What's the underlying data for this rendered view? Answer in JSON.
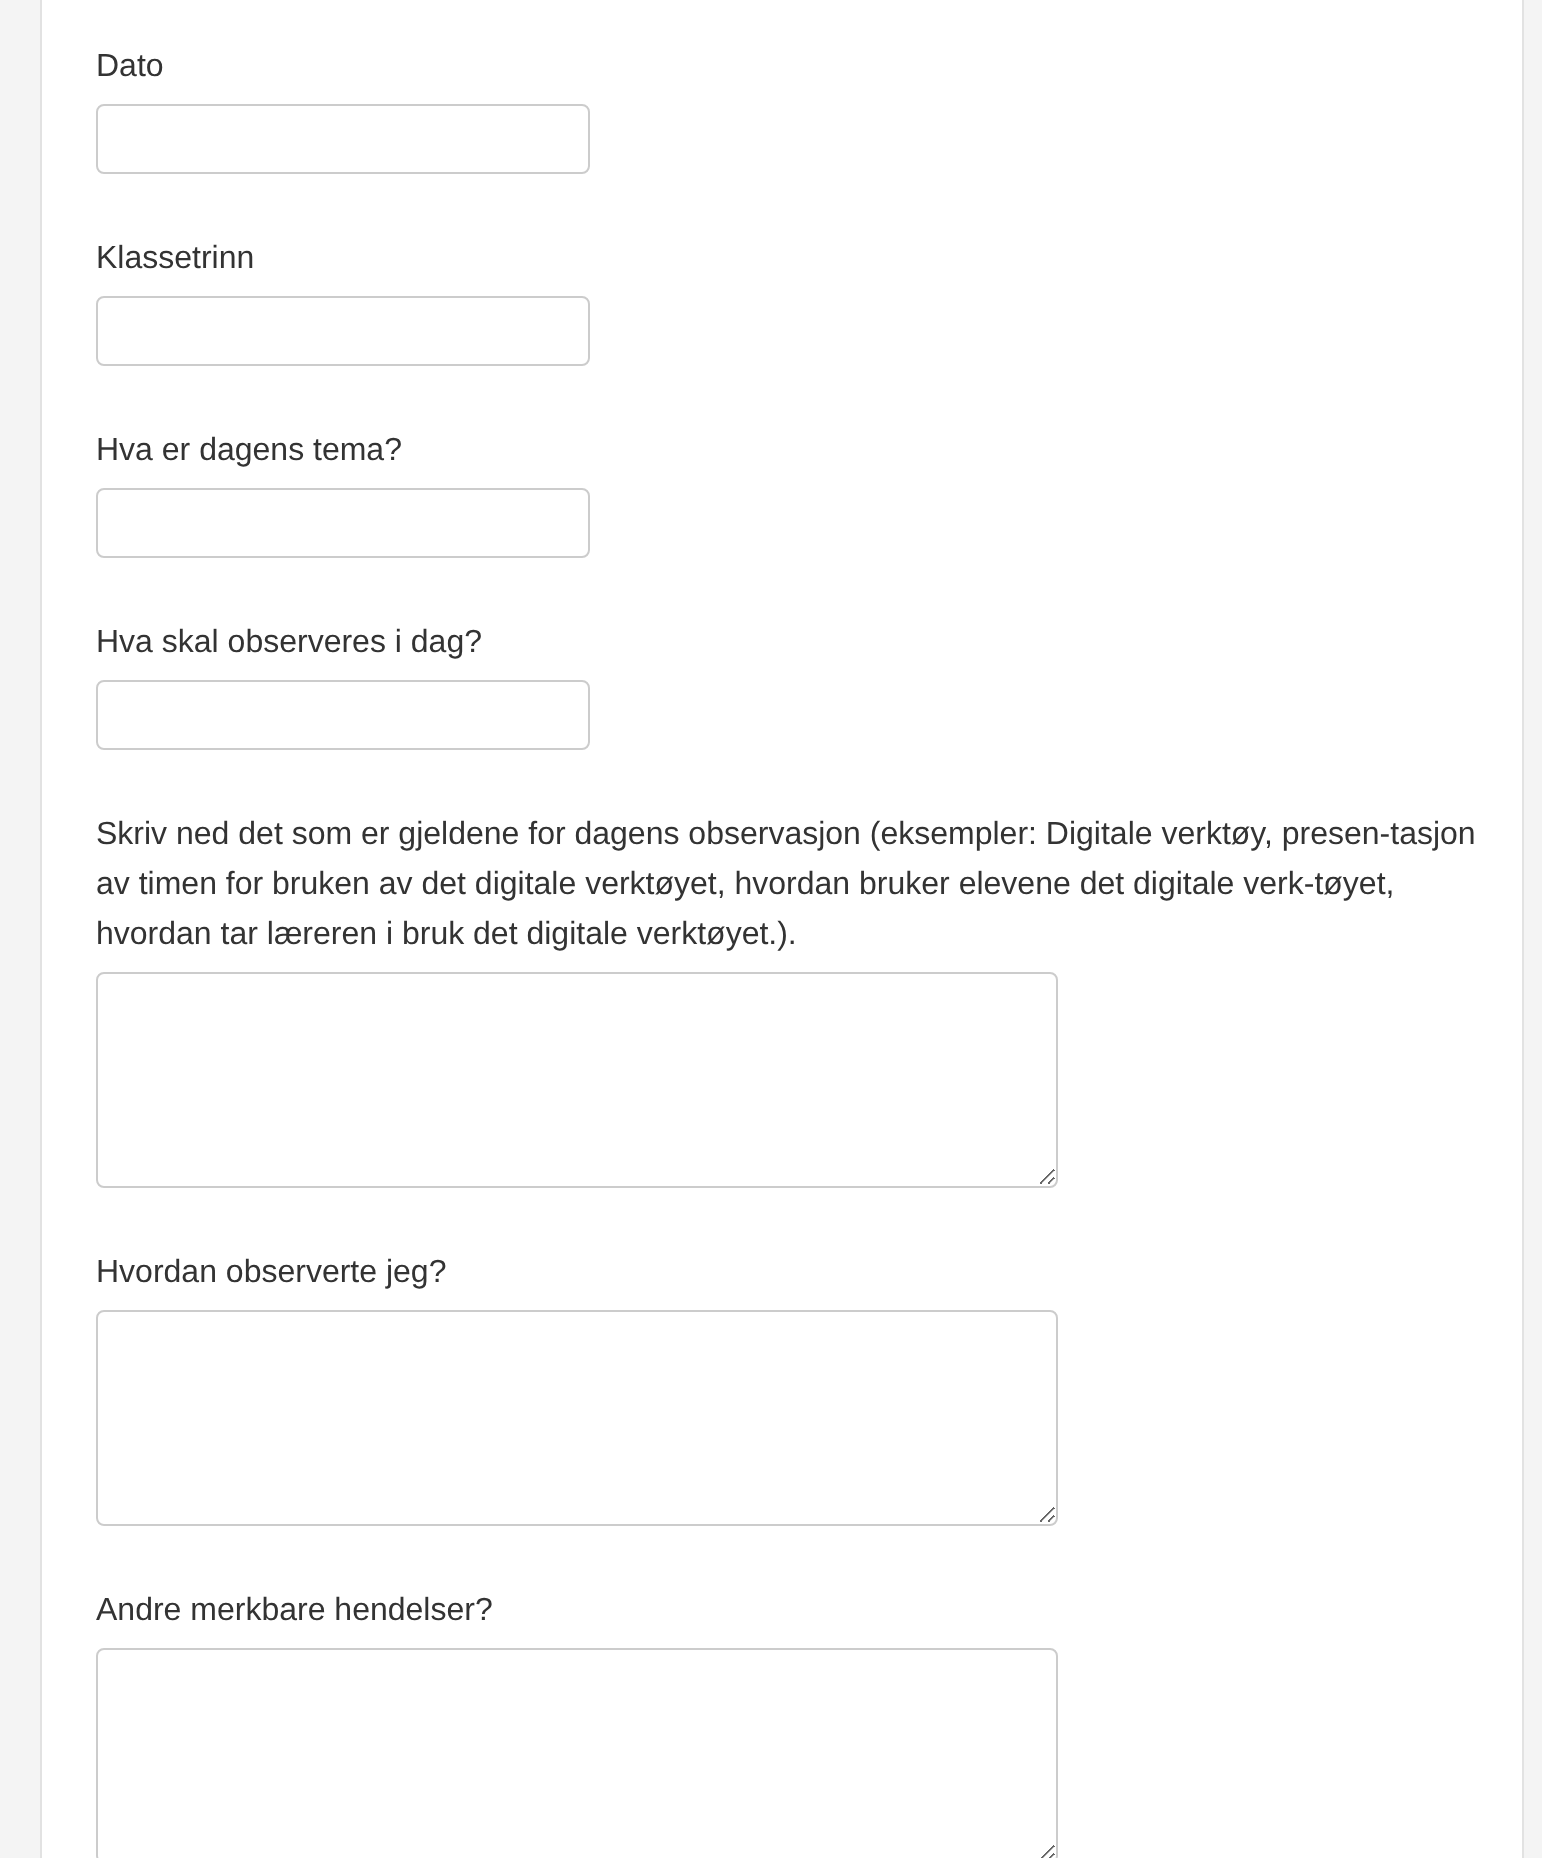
{
  "fields": [
    {
      "label": "Dato",
      "kind": "input"
    },
    {
      "label": "Klassetrinn",
      "kind": "input"
    },
    {
      "label": "Hva er dagens tema?",
      "kind": "input"
    },
    {
      "label": "Hva skal observeres i dag?",
      "kind": "input"
    },
    {
      "label": "Skriv ned det som er gjeldene for dagens observasjon (eksempler: Digitale verktøy, presen-tasjon av timen for bruken av det digitale verktøyet, hvordan bruker elevene det digitale verk-tøyet, hvordan tar læreren i bruk det digitale verktøyet.).",
      "kind": "textarea"
    },
    {
      "label": "Hvordan observerte jeg?",
      "kind": "textarea"
    },
    {
      "label": "Andre merkbare hendelser?",
      "kind": "textarea"
    }
  ]
}
